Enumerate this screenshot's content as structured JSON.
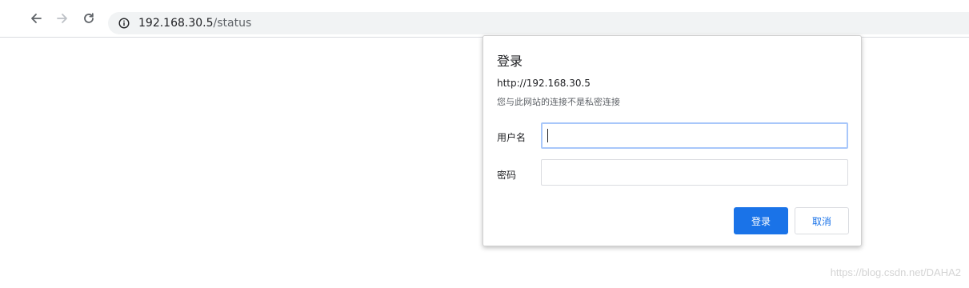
{
  "browser": {
    "url_host": "192.168.30.5",
    "url_path": "/status",
    "icons": {
      "back": "arrow-left-icon",
      "forward": "arrow-right-icon",
      "reload": "reload-icon",
      "site_info": "info-circle-icon"
    }
  },
  "dialog": {
    "title": "登录",
    "origin": "http://192.168.30.5",
    "warning": "您与此网站的连接不是私密连接",
    "username_label": "用户名",
    "username_value": "",
    "password_label": "密码",
    "password_value": "",
    "login_button": "登录",
    "cancel_button": "取消"
  },
  "watermark": "https://blog.csdn.net/DAHA2",
  "colors": {
    "accent": "#1a73e8",
    "focus_border": "#a8c7fa",
    "omnibox_bg": "#f1f3f4"
  }
}
